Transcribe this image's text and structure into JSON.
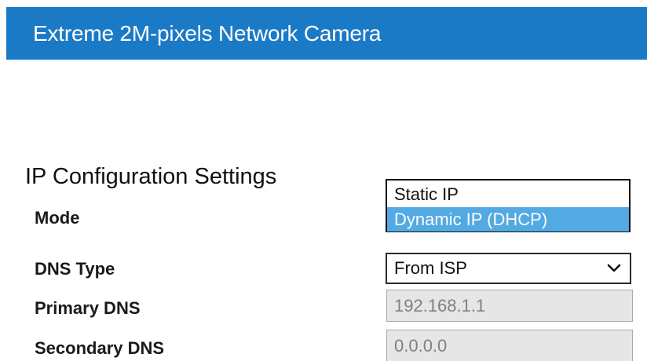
{
  "header": {
    "title": "Extreme 2M-pixels Network Camera"
  },
  "ip_config": {
    "section_title": "IP Configuration Settings",
    "mode": {
      "label": "Mode",
      "options": [
        "Static IP",
        "Dynamic IP (DHCP)"
      ],
      "highlighted_option": "Dynamic IP (DHCP)"
    },
    "dns_type": {
      "label": "DNS Type",
      "value": "From ISP",
      "icon": "chevron-down-icon"
    },
    "primary_dns": {
      "label": "Primary DNS",
      "value": "192.168.1.1"
    },
    "secondary_dns": {
      "label": "Secondary DNS",
      "value": "0.0.0.0"
    }
  },
  "colors": {
    "header_bg": "#1b7ac6",
    "highlight_bg": "#53a9e2",
    "disabled_input_bg": "#e6e6e6"
  }
}
